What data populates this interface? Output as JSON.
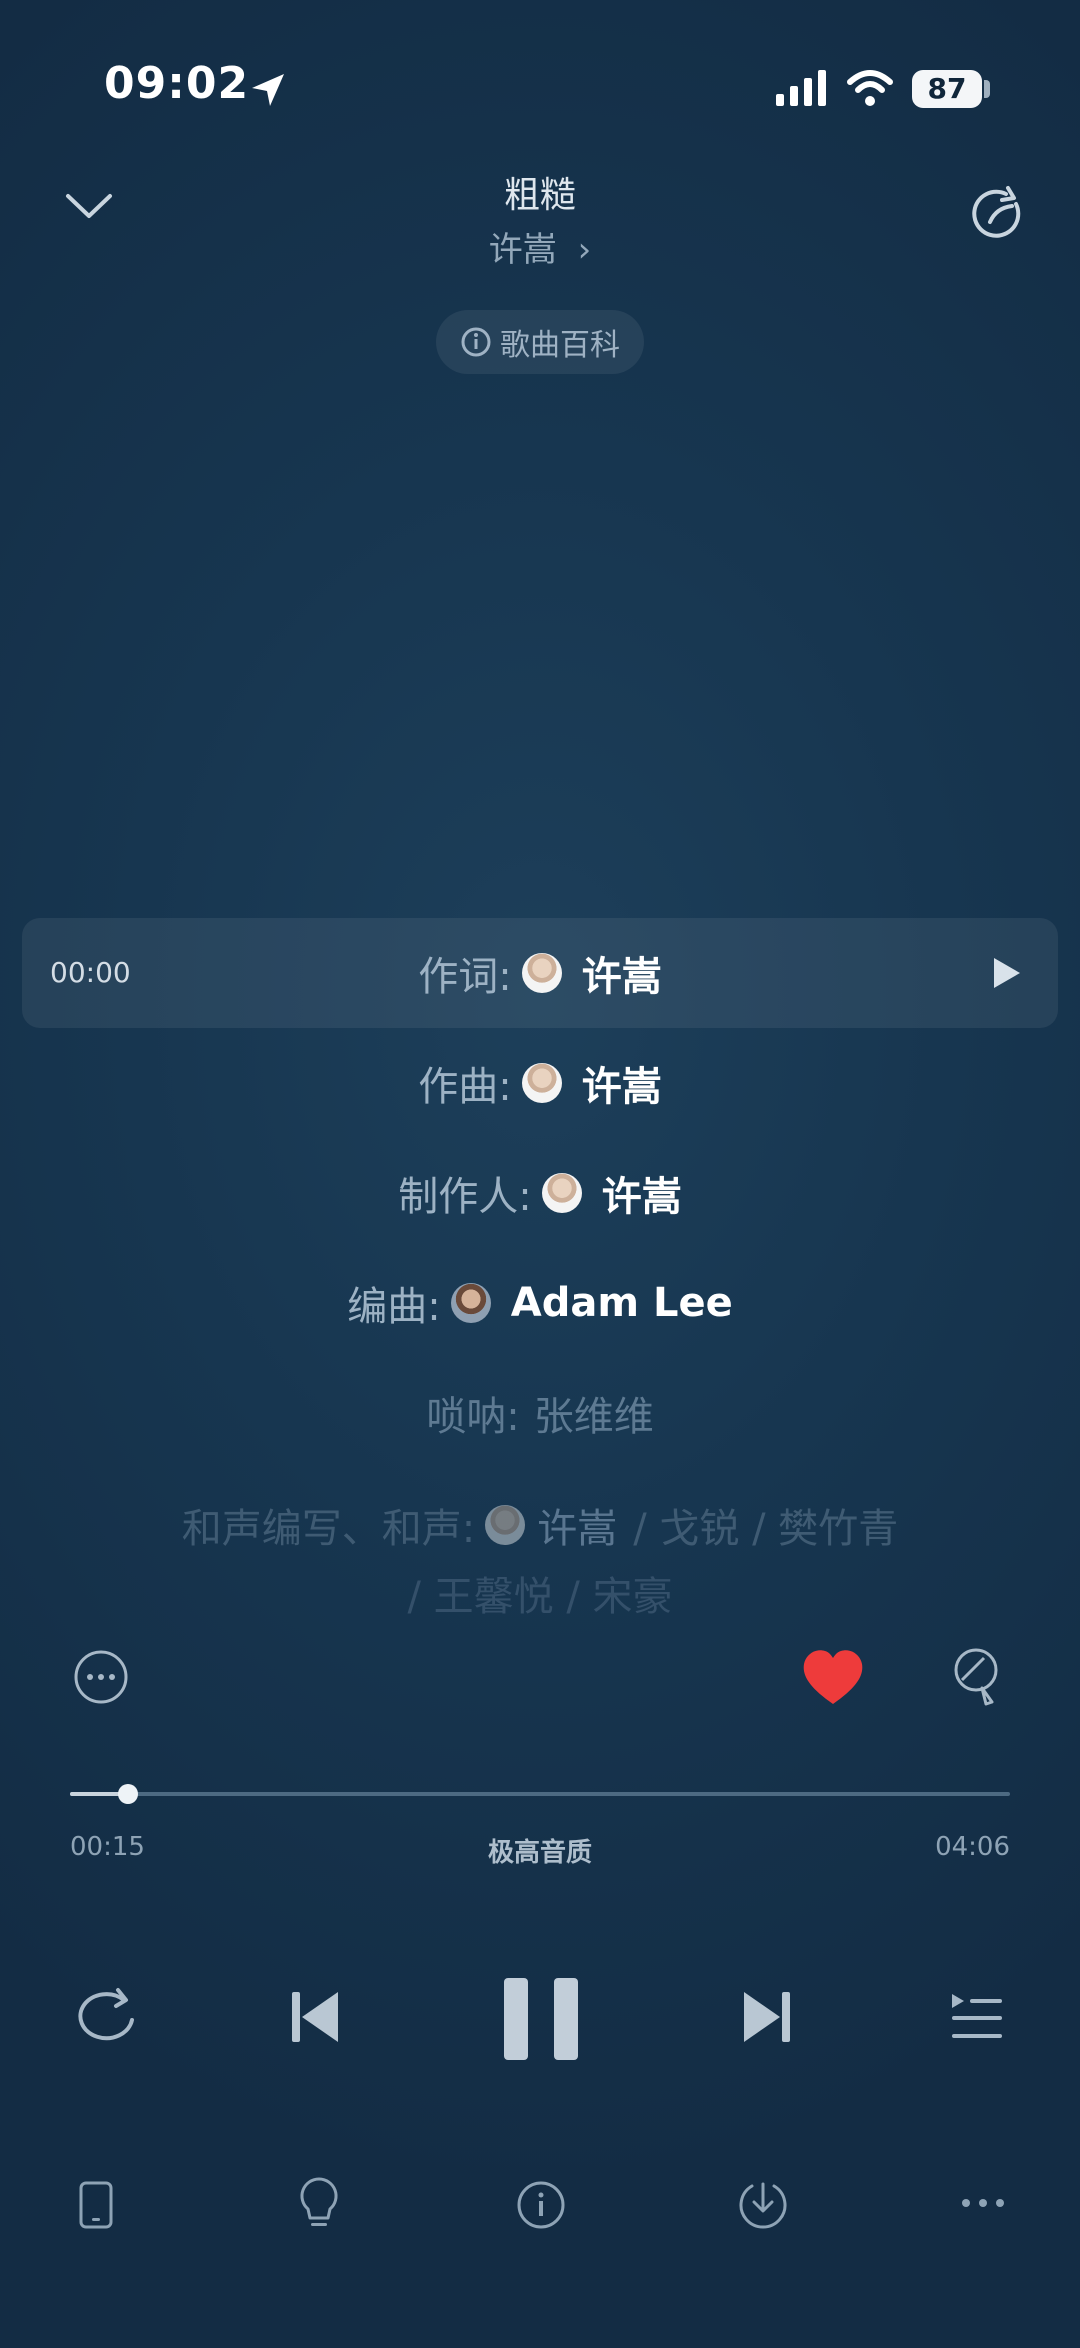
{
  "status_bar": {
    "time": "09:02",
    "battery": "87"
  },
  "header": {
    "song_title": "粗糙",
    "artist": "许嵩",
    "wiki_label": "歌曲百科"
  },
  "credits": {
    "current_time": "00:00",
    "rows": [
      {
        "role": "作词:",
        "name": "许嵩"
      },
      {
        "role": "作曲:",
        "name": "许嵩"
      },
      {
        "role": "制作人:",
        "name": "许嵩"
      },
      {
        "role": "编曲:",
        "name": "Adam Lee"
      },
      {
        "role": "唢呐:",
        "name": "张维维"
      },
      {
        "role": "和声编写、和声:",
        "name": "许嵩",
        "others": "/ 戈锐 / 樊竹青",
        "others2": "/ 王馨悦 / 宋豪"
      }
    ]
  },
  "player": {
    "elapsed": "00:15",
    "duration": "04:06",
    "quality": "极高音质",
    "progress": 0.062,
    "liked": true,
    "accent_color": "#ee3b3b"
  },
  "icons": {
    "top": [
      "chevron-down-icon",
      "share-icon"
    ],
    "actions": [
      "more-circle-icon",
      "heart-icon",
      "comment-icon"
    ],
    "transport": [
      "repeat-icon",
      "previous-icon",
      "pause-icon",
      "next-icon",
      "playlist-icon"
    ],
    "bottom": [
      "device-icon",
      "lightbulb-icon",
      "info-icon",
      "download-icon",
      "more-icon"
    ]
  }
}
